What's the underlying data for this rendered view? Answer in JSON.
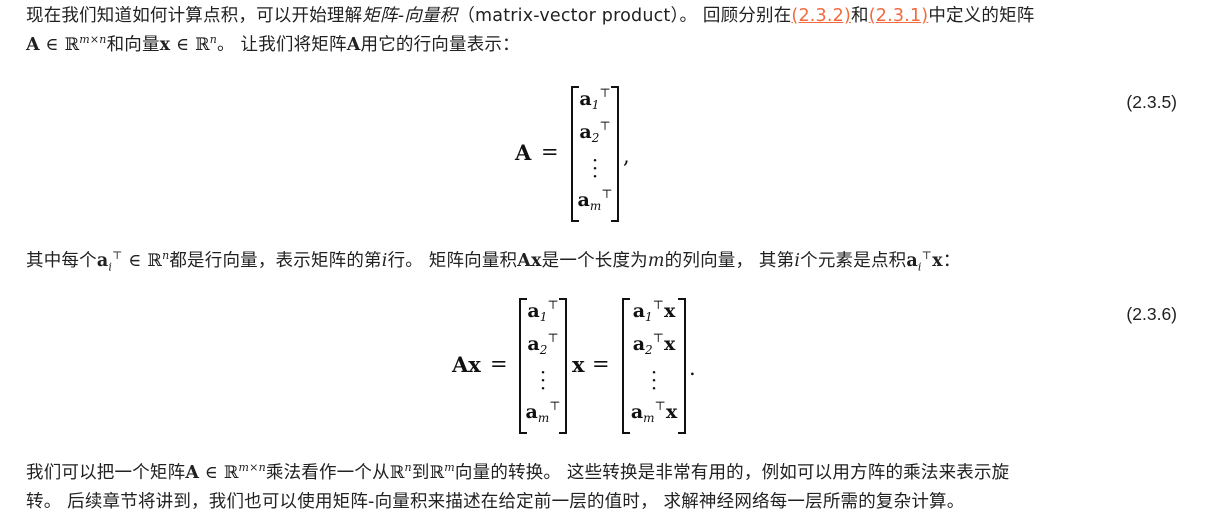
{
  "para1": {
    "line1_a": "现在我们知道如何计算点积，可以开始理解",
    "term": "矩阵-向量积",
    "line1_b": "（matrix-vector product）。 回顾分别在",
    "ref1": "(2.3.2)",
    "and": "和",
    "ref2": "(2.3.1)",
    "line1_c": "中定义的矩阵",
    "line2_a": "和向量",
    "line2_b": "。 让我们将矩阵",
    "line2_c": "用它的行向量表示："
  },
  "eq1": {
    "number": "(2.3.5)"
  },
  "para2": {
    "a": "其中每个",
    "b": "都是行向量，表示矩阵的第",
    "c": "行。 矩阵向量积",
    "d": "是一个长度为",
    "e": "的列向量， 其第",
    "f": "个元素是点积",
    "g": "："
  },
  "eq2": {
    "number": "(2.3.6)"
  },
  "para3": {
    "line1_a": "我们可以把一个矩阵",
    "line1_b": "乘法看作一个从",
    "line1_c": "到",
    "line1_d": "向量的转换。 这些转换是非常有用的，例如可以用方阵的乘法来表示旋",
    "line2": "转。 后续章节将讲到，我们也可以使用矩阵-向量积来描述在给定前一层的值时， 求解神经网络每一层所需的复杂计算。"
  }
}
